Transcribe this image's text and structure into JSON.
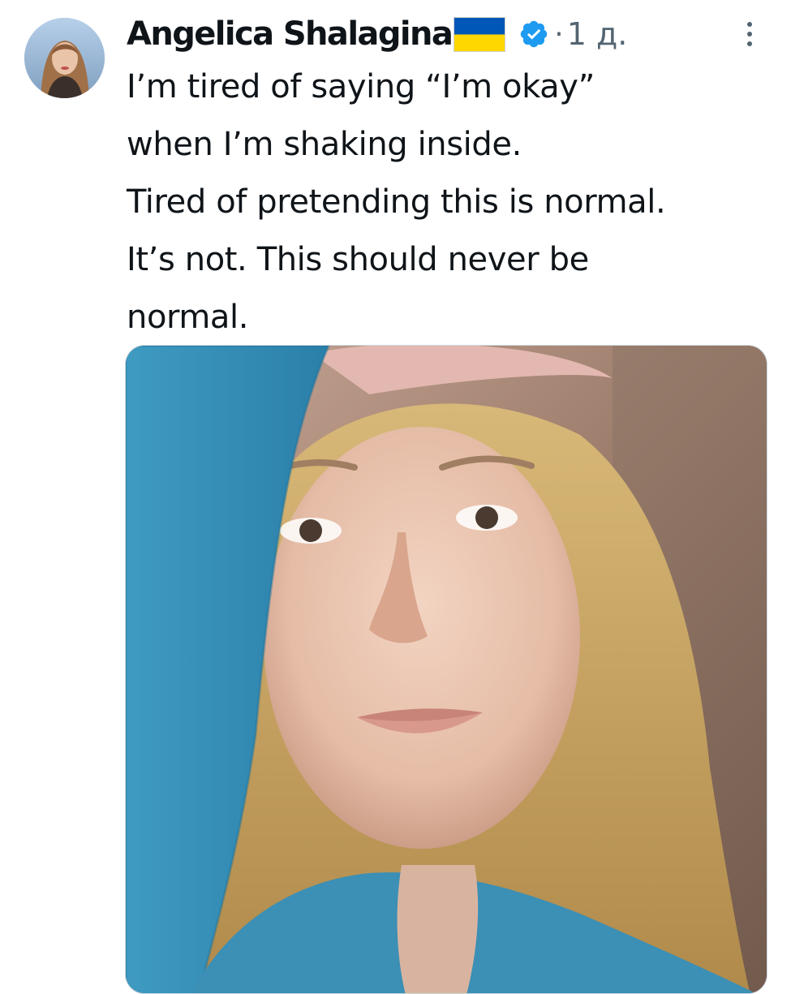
{
  "tweet": {
    "author_name": "Angelica Shalagina",
    "separator": "·",
    "timestamp": "1 д.",
    "text_lines": [
      "I’m tired of saying “I’m okay”",
      "when I’m shaking inside.",
      "Tired of pretending this is normal.",
      "It’s not. This should never be",
      "normal."
    ]
  },
  "icons": {
    "flag": "ukraine-flag-icon",
    "verified": "verified-badge-icon",
    "more": "more-options-icon",
    "avatar": "avatar"
  },
  "colors": {
    "text": "#0f1419",
    "secondary": "#536471",
    "verified": "#1d9bf0",
    "flag_blue": "#0057b7",
    "flag_yellow": "#ffd700"
  }
}
